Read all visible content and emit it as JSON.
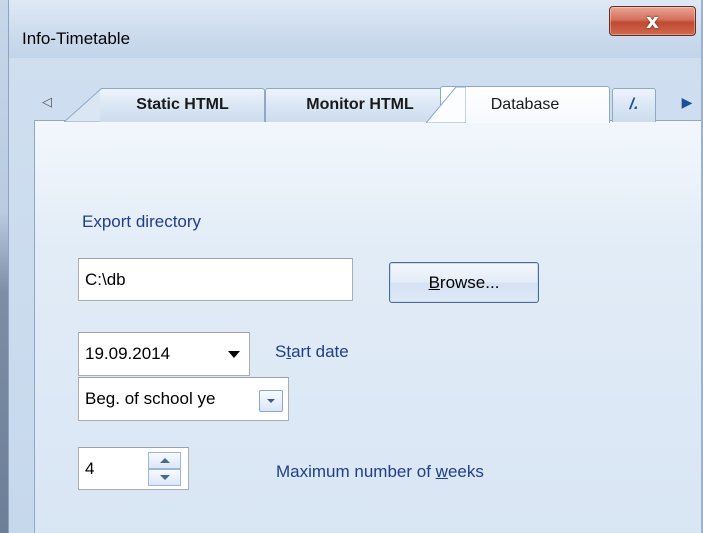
{
  "window": {
    "title": "Info-Timetable",
    "close_glyph": "x"
  },
  "tabs": {
    "scroll_left_glyph": "◁",
    "scroll_right_glyph": "▶",
    "items": [
      {
        "label": "Static HTML",
        "active": false
      },
      {
        "label": "Monitor HTML",
        "active": false
      },
      {
        "label": "Database",
        "active": true
      },
      {
        "label": "/.",
        "active": false
      }
    ]
  },
  "database": {
    "export_directory_label": "Export directory",
    "export_directory_value": "C:\\db",
    "browse_button": {
      "prefix": "",
      "mnemonic": "B",
      "rest": "rowse..."
    },
    "start_date_value": "19.09.2014",
    "start_date_label": {
      "prefix": "S",
      "mnemonic": "t",
      "rest": "art date"
    },
    "start_mode_value": "Beg. of school ye",
    "weeks_value": "4",
    "max_weeks_label": {
      "prefix": "Maximum number of ",
      "mnemonic": "w",
      "rest": "eeks"
    }
  }
}
